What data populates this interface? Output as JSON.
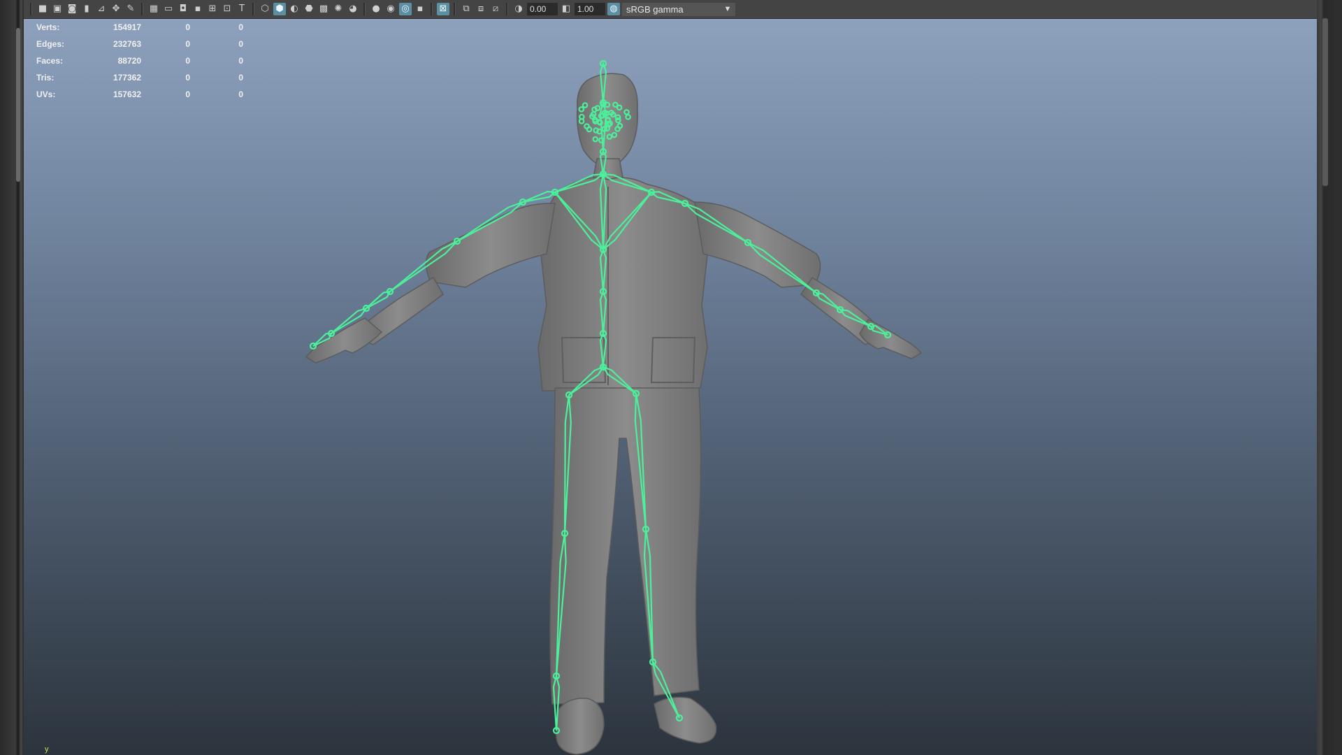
{
  "toolbar": {
    "exposure_value": "0.00",
    "gamma_value": "1.00",
    "color_space": "sRGB gamma",
    "icons": [
      "camera-icon",
      "camera-lock-icon",
      "camera-attributes-icon",
      "bookmark-icon",
      "image-plane-icon",
      "2d-pan-zoom-icon",
      "grease-pencil-icon",
      "grid-icon",
      "film-gate-icon",
      "resolution-gate-icon",
      "gate-mask-icon",
      "field-chart-icon",
      "safe-action-icon",
      "safe-title-icon",
      "wireframe-icon",
      "smooth-shade-icon",
      "default-material-icon",
      "wireframe-on-shaded-icon",
      "textured-icon",
      "use-all-lights-icon",
      "shadows-icon",
      "screen-space-ao-icon",
      "motion-blur-icon",
      "anti-aliasing-icon",
      "depth-of-field-icon",
      "isolate-select-icon",
      "xray-icon",
      "xray-active-components-icon",
      "xray-joints-icon",
      "exposure-icon",
      "gamma-icon",
      "color-management-icon"
    ]
  },
  "hud": {
    "rows": [
      {
        "label": "Verts:",
        "value": "154917",
        "sel": "0",
        "extra": "0"
      },
      {
        "label": "Edges:",
        "value": "232763",
        "sel": "0",
        "extra": "0"
      },
      {
        "label": "Faces:",
        "value": "88720",
        "sel": "0",
        "extra": "0"
      },
      {
        "label": "Tris:",
        "value": "177362",
        "sel": "0",
        "extra": "0"
      },
      {
        "label": "UVs:",
        "value": "157632",
        "sel": "0",
        "extra": "0"
      }
    ]
  },
  "viewport": {
    "axis_label": "y",
    "joint_color": "#4cf09a",
    "mesh_color": "#7f7f7f"
  }
}
